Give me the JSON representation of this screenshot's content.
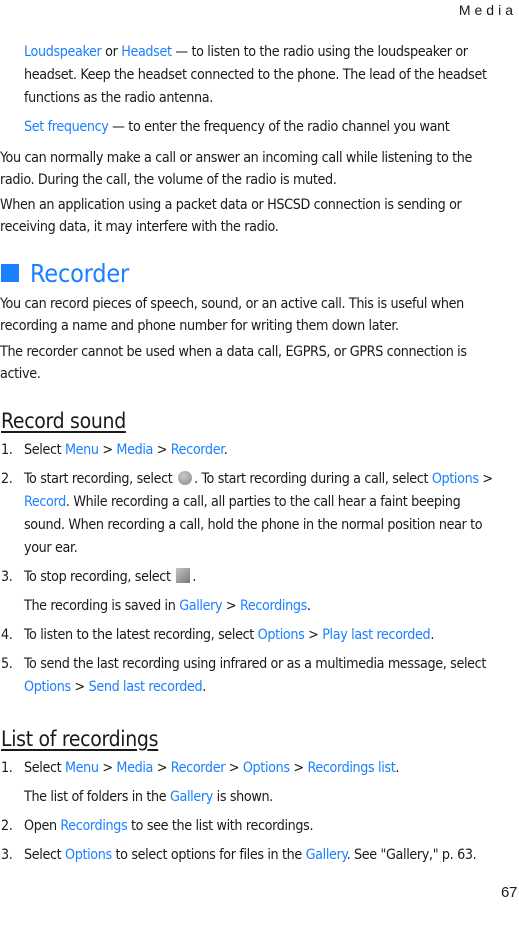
{
  "running_head": "Media",
  "page_number": "67",
  "intro": {
    "item1": {
      "a": "Loudspeaker",
      "or": " or ",
      "b": "Headset",
      "rest1": " — to listen to the radio using the loudspeaker or",
      "line2": "headset. Keep the headset connected to the phone. The lead of the headset",
      "line3": "functions as the radio antenna."
    },
    "item2": {
      "a": "Set frequency",
      "rest": " — to enter the frequency of the radio channel you want"
    },
    "para1": {
      "line1": "You can normally make a call or answer an incoming call while listening to the",
      "line2": "radio. During the call, the volume of the radio is muted."
    },
    "para2": {
      "line1": "When an application using a packet data or HSCSD connection is sending or",
      "line2": "receiving data, it may interfere with the radio."
    }
  },
  "recorder": {
    "title": "Recorder",
    "para1": {
      "line1": "You can record pieces of speech, sound, or an active call. This is useful when",
      "line2": "recording a name and phone number for writing them down later."
    },
    "para2": {
      "line1": "The recorder cannot be used when a data call, EGPRS, or GPRS connection is",
      "line2": "active."
    }
  },
  "record_sound": {
    "title": "Record sound",
    "steps": [
      {
        "num": "1.",
        "t0": "Select ",
        "l1": "Menu",
        "s1": " > ",
        "l2": "Media",
        "s2": " > ",
        "l3": "Recorder",
        "end": "."
      },
      {
        "num": "2.",
        "t0": "To start recording, select ",
        "icon": "record-icon",
        "t1": ". To start recording during a call, select ",
        "l1": "Options",
        "s1": " >",
        "l2": "Record",
        "t2": ". While recording a call, all parties to the call hear a faint beeping",
        "line3": "sound. When recording a call, hold the phone in the normal position near to",
        "line4": "your ear."
      },
      {
        "num": "3.",
        "t0": "To stop recording, select ",
        "icon": "stop-icon",
        "end": ".",
        "sub_t0": "The recording is saved in ",
        "sub_l1": "Gallery",
        "sub_s1": " > ",
        "sub_l2": "Recordings",
        "sub_end": "."
      },
      {
        "num": "4.",
        "t0": "To listen to the latest recording, select ",
        "l1": "Options",
        "s1": " > ",
        "l2": "Play last recorded",
        "end": "."
      },
      {
        "num": "5.",
        "t0": "To send the last recording using infrared or as a multimedia message, select",
        "l1": "Options",
        "s1": " > ",
        "l2": "Send last recorded",
        "end": "."
      }
    ]
  },
  "list_of_recordings": {
    "title": "List of recordings",
    "steps": [
      {
        "num": "1.",
        "t0": "Select ",
        "l1": "Menu",
        "s1": " > ",
        "l2": "Media",
        "s2": " > ",
        "l3": "Recorder",
        "s3": " > ",
        "l4": "Options",
        "s4": " > ",
        "l5": "Recordings list",
        "end": ".",
        "sub_t0": "The list of folders in the ",
        "sub_l1": "Gallery",
        "sub_end": " is shown."
      },
      {
        "num": "2.",
        "t0": "Open ",
        "l1": "Recordings",
        "end": " to see the list with recordings."
      },
      {
        "num": "3.",
        "t0": "Select ",
        "l1": "Options",
        "t1": " to select options for files in the ",
        "l2": "Gallery",
        "end": ". See \"Gallery,\" p. 63."
      }
    ]
  }
}
